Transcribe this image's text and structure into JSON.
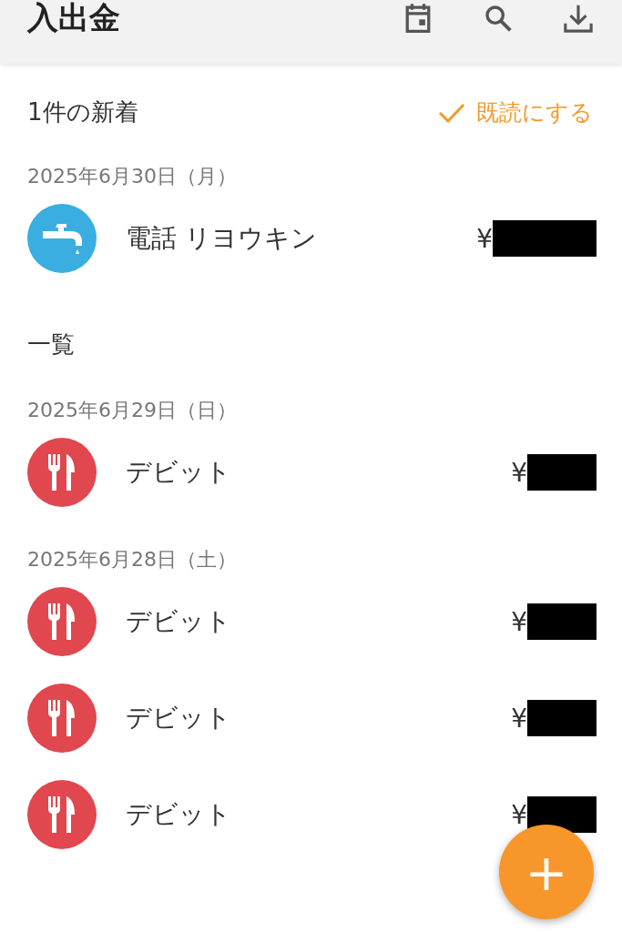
{
  "header": {
    "title": "入出金",
    "actions": [
      {
        "kind": "calendar"
      },
      {
        "kind": "search"
      },
      {
        "kind": "download"
      }
    ]
  },
  "new_section": {
    "title": "1件の新着",
    "mark_read": "既読にする"
  },
  "new_groups": [
    {
      "date": "2025年6月30日（月）",
      "items": [
        {
          "kind": "utility",
          "name": "電話 リヨウキン",
          "currency": "¥",
          "color": "#3aaee0"
        }
      ]
    }
  ],
  "list_section": {
    "title": "一覧"
  },
  "groups": [
    {
      "date": "2025年6月29日（日）",
      "items": [
        {
          "kind": "food",
          "name": "デビット",
          "currency": "¥",
          "color": "#e0474f"
        }
      ]
    },
    {
      "date": "2025年6月28日（土）",
      "items": [
        {
          "kind": "food",
          "name": "デビット",
          "currency": "¥",
          "color": "#e0474f"
        },
        {
          "kind": "food",
          "name": "デビット",
          "currency": "¥",
          "color": "#e0474f"
        },
        {
          "kind": "food",
          "name": "デビット",
          "currency": "¥",
          "color": "#e0474f"
        }
      ]
    }
  ],
  "fab": {
    "label": "+"
  }
}
